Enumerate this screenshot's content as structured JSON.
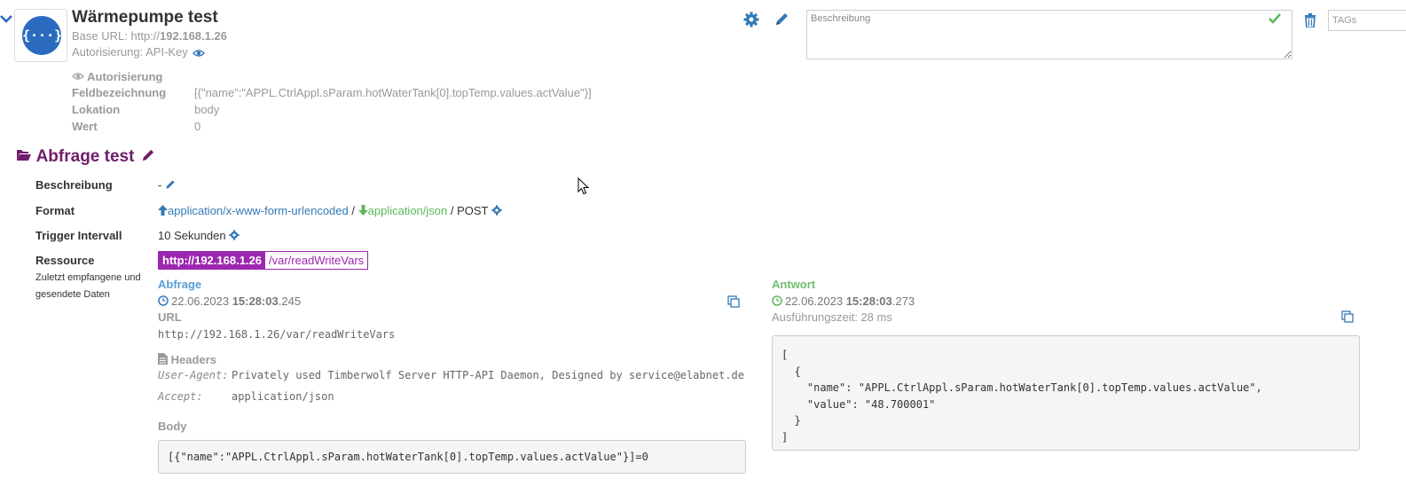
{
  "device": {
    "title": "Wärmepumpe test",
    "base_url_label": "Base URL:",
    "base_url_scheme": "http://",
    "base_url_host": "192.168.1.26",
    "auth_label": "Autorisierung:",
    "auth_value": "API-Key",
    "logo_glyph": "{···}",
    "description_placeholder": "Beschreibung",
    "tags_placeholder": "TAGs"
  },
  "auth_details": {
    "heading": "Autorisierung",
    "fields": [
      {
        "label": "Feldbezeichnung",
        "value": "[{\"name\":\"APPL.CtrlAppl.sParam.hotWaterTank[0].topTemp.values.actValue\"}]"
      },
      {
        "label": "Lokation",
        "value": "body"
      },
      {
        "label": "Wert",
        "value": "0"
      }
    ]
  },
  "query": {
    "title": "Abfrage test",
    "description_label": "Beschreibung",
    "description_value": "-",
    "format_label": "Format",
    "format_request": "application/x-www-form-urlencoded",
    "format_separator": "/",
    "format_response": "application/json",
    "format_method": "/ POST",
    "trigger_label": "Trigger Intervall",
    "trigger_value": "10 Sekunden",
    "resource_label": "Ressource",
    "resource_sublabel": "Zuletzt empfangene und gesendete Daten",
    "resource_host": "http://192.168.1.26",
    "resource_path": "/var/readWriteVars"
  },
  "request": {
    "heading": "Abfrage",
    "date": "22.06.2023",
    "time_main": "15:28:03",
    "time_ms": ".245",
    "url_label": "URL",
    "url": "http://192.168.1.26/var/readWriteVars",
    "headers_label": "Headers",
    "headers": [
      {
        "key": "User-Agent:",
        "value": "Privately used Timberwolf Server HTTP-API Daemon, Designed by service@elabnet.de"
      },
      {
        "key": "Accept:",
        "value": "application/json"
      }
    ],
    "body_label": "Body",
    "body": "[{\"name\":\"APPL.CtrlAppl.sParam.hotWaterTank[0].topTemp.values.actValue\"}]=0"
  },
  "response": {
    "heading": "Antwort",
    "date": "22.06.2023",
    "time_main": "15:28:03",
    "time_ms": ".273",
    "exec_time": "Ausführungszeit: 28 ms",
    "body": "[\n  {\n    \"name\": \"APPL.CtrlAppl.sParam.hotWaterTank[0].topTemp.values.actValue\",\n    \"value\": \"48.700001\"\n  }\n]"
  },
  "colors": {
    "accent_blue": "#337ab7",
    "accent_green": "#5cb85c",
    "resource_purple": "#9c27b0",
    "section_title": "#6f1d6b"
  },
  "icons": [
    "chevron-down-icon",
    "logo-icon",
    "eye-icon",
    "gear-icon",
    "pencil-icon",
    "check-icon",
    "trash-icon",
    "folder-open-icon",
    "arrow-up-icon",
    "arrow-down-icon",
    "clock-icon",
    "file-icon",
    "copy-icon",
    "mouse-cursor-icon"
  ]
}
